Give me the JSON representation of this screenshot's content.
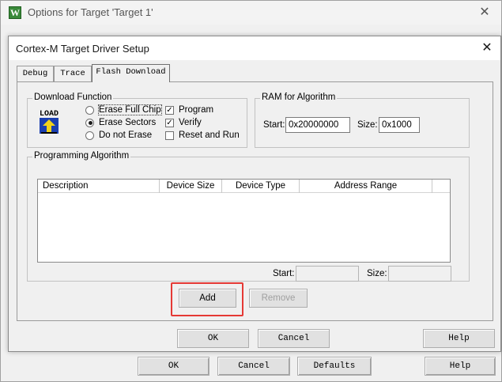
{
  "outer_window": {
    "app_icon_glyph": "W",
    "title": "Options for Target 'Target 1'",
    "close_glyph": "✕",
    "buttons": {
      "ok": "OK",
      "cancel": "Cancel",
      "defaults": "Defaults",
      "help": "Help"
    }
  },
  "dialog": {
    "title": "Cortex-M Target Driver Setup",
    "close_glyph": "✕",
    "tabs": [
      {
        "label": "Debug",
        "active": false
      },
      {
        "label": "Trace",
        "active": false
      },
      {
        "label": "Flash Download",
        "active": true
      }
    ],
    "download_function": {
      "legend": "Download Function",
      "load_icon_text": "LOAD",
      "erase_options": [
        {
          "label": "Erase Full Chip",
          "selected": false
        },
        {
          "label": "Erase Sectors",
          "selected": true
        },
        {
          "label": "Do not Erase",
          "selected": false
        }
      ],
      "checks": [
        {
          "label": "Program",
          "checked": true
        },
        {
          "label": "Verify",
          "checked": true
        },
        {
          "label": "Reset and Run",
          "checked": false
        }
      ]
    },
    "ram_for_algorithm": {
      "legend": "RAM for Algorithm",
      "start_label": "Start:",
      "start_value": "0x20000000",
      "size_label": "Size:",
      "size_value": "0x1000"
    },
    "programming_algorithm": {
      "legend": "Programming Algorithm",
      "columns": [
        "Description",
        "Device Size",
        "Device Type",
        "Address Range"
      ],
      "rows": [],
      "start_label": "Start:",
      "start_value": "",
      "size_label": "Size:",
      "size_value": ""
    },
    "buttons": {
      "add": "Add",
      "remove": "Remove",
      "ok": "OK",
      "cancel": "Cancel",
      "help": "Help"
    },
    "highlight_color": "#e53935"
  }
}
